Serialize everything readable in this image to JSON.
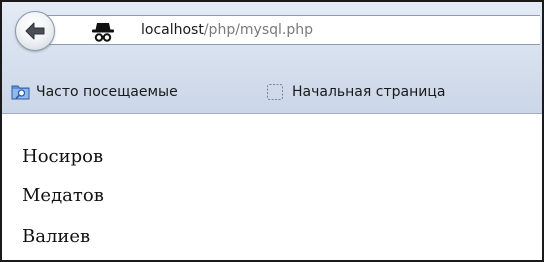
{
  "navigation": {
    "back_icon": "back-arrow-icon",
    "site_icon": "incognito-spy-icon",
    "url_host": "localhost",
    "url_path": "/php/mysql.php"
  },
  "bookmarks": [
    {
      "label": "Часто посещаемые",
      "icon": "folder-search-icon"
    },
    {
      "label": "Начальная страница",
      "icon": "blank-page-icon"
    }
  ],
  "content": {
    "rows": [
      "Носиров",
      "Медатов",
      "Валиев"
    ]
  }
}
